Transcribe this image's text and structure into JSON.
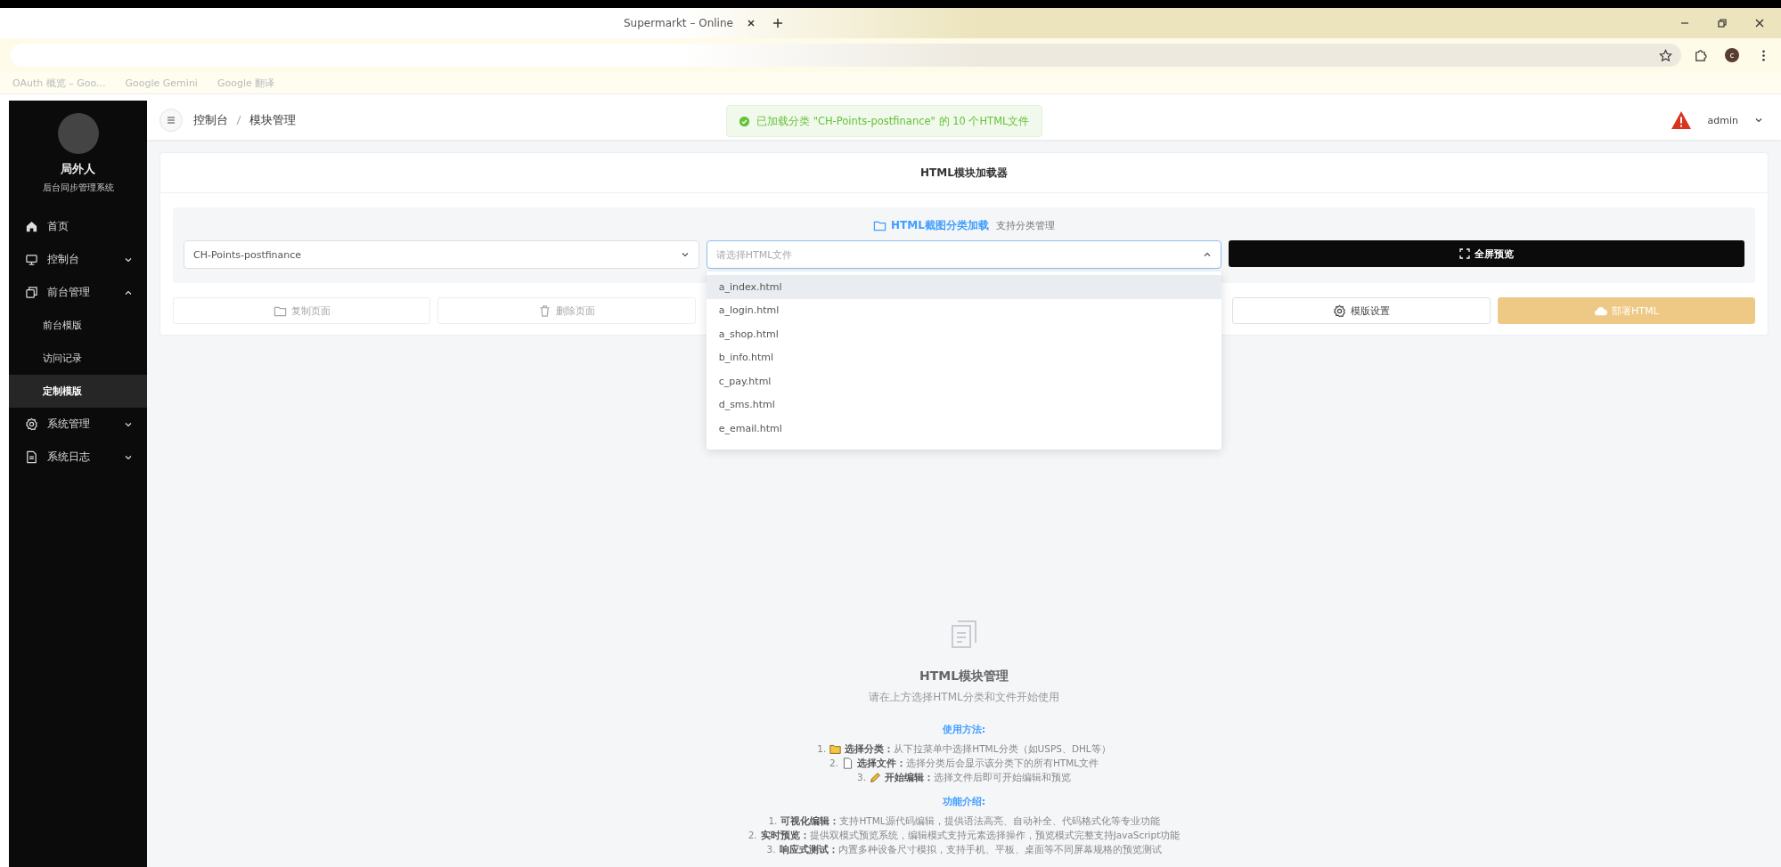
{
  "browser": {
    "tab_title": "Supermarkt – Online",
    "profile": "c",
    "bookmarks": [
      "OAuth 概览 – Goo...",
      "Google Gemini",
      "Google 翻译"
    ]
  },
  "sidebar": {
    "username": "局外人",
    "subtitle": "后台同步管理系统",
    "items": [
      {
        "label": "首页"
      },
      {
        "label": "控制台",
        "expanded": false
      },
      {
        "label": "前台管理",
        "expanded": true,
        "children": [
          {
            "label": "前台模版",
            "selected": false
          },
          {
            "label": "访问记录",
            "selected": false
          },
          {
            "label": "定制模版",
            "selected": true
          }
        ]
      },
      {
        "label": "系统管理",
        "expanded": false
      },
      {
        "label": "系统日志",
        "expanded": false
      }
    ]
  },
  "header": {
    "breadcrumb": [
      "控制台",
      "模块管理"
    ],
    "toast": "已加载分类 \"CH-Points-postfinance\" 的 10 个HTML文件",
    "user": "admin"
  },
  "loader": {
    "title": "HTML模块加载器",
    "section_title": "HTML截图分类加载",
    "section_hint": "支持分类管理",
    "category_select": {
      "value": "CH-Points-postfinance"
    },
    "file_select": {
      "placeholder": "请选择HTML文件",
      "open": true,
      "options": [
        {
          "label": "a_index.html",
          "highlighted": true
        },
        {
          "label": "a_login.html",
          "highlighted": false
        },
        {
          "label": "a_shop.html",
          "highlighted": false
        },
        {
          "label": "b_info.html",
          "highlighted": false
        },
        {
          "label": "c_pay.html",
          "highlighted": false
        },
        {
          "label": "d_sms.html",
          "highlighted": false
        },
        {
          "label": "e_email.html",
          "highlighted": false
        }
      ]
    },
    "fullscreen_button": "全屏预览",
    "actions": [
      {
        "label": "复制页面",
        "kind": "outline",
        "disabled": true
      },
      {
        "label": "删除页面",
        "kind": "outline",
        "disabled": true
      },
      {
        "label": "模版设置",
        "kind": "outline",
        "disabled": false
      },
      {
        "label": "部署HTML",
        "kind": "warning",
        "disabled": true
      }
    ]
  },
  "empty_state": {
    "title": "HTML模块管理",
    "subtitle": "请在上方选择HTML分类和文件开始使用",
    "usage_title": "使用方法:",
    "usage": [
      {
        "number": "1.",
        "text": "**选择分类：**从下拉菜单中选择HTML分类（如USPS、DHL等）"
      },
      {
        "number": "2.",
        "text": "**选择文件：**选择分类后会显示该分类下的所有HTML文件"
      },
      {
        "number": "3.",
        "text": "**开始编辑：**选择文件后即可开始编辑和预览"
      }
    ],
    "features_title": "功能介绍:",
    "features": [
      {
        "number": "1.",
        "text": "**可视化编辑：**支持HTML源代码编辑，提供语法高亮、自动补全、代码格式化等专业功能"
      },
      {
        "number": "2.",
        "text": "**实时预览：**提供双模式预览系统，编辑模式支持元素选择操作，预览模式完整支持JavaScript功能"
      },
      {
        "number": "3.",
        "text": "**响应式测试：**内置多种设备尺寸模拟，支持手机、平板、桌面等不同屏幕规格的预览测试"
      }
    ]
  }
}
